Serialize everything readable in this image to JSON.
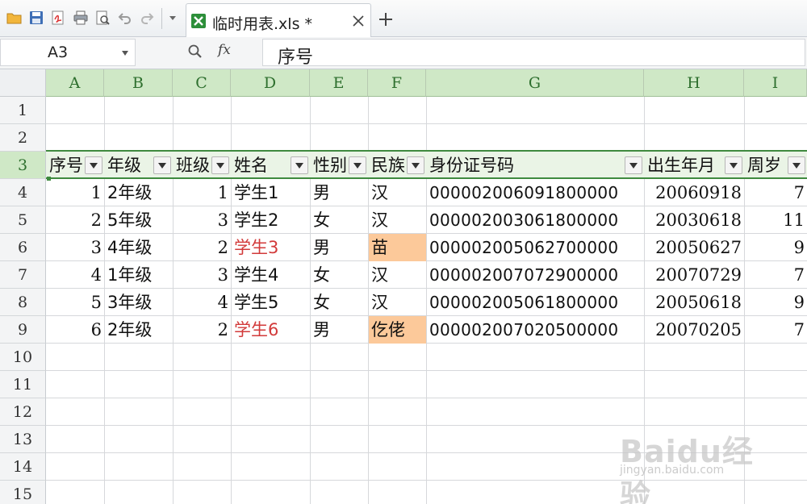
{
  "toolbar": {
    "icons": [
      "open-folder-icon",
      "save-icon",
      "export-pdf-icon",
      "print-icon",
      "print-preview-icon",
      "undo-icon",
      "redo-icon",
      "dropdown-icon"
    ],
    "tab": {
      "title": "临时用表.xls *",
      "icon": "excel-file-icon"
    }
  },
  "formula_bar": {
    "name_box": "A3",
    "fx_label": "fx",
    "formula": "序号"
  },
  "sheet": {
    "columns": [
      "A",
      "B",
      "C",
      "D",
      "E",
      "F",
      "G",
      "H",
      "I"
    ],
    "rows": [
      "1",
      "2",
      "3",
      "4",
      "5",
      "6",
      "7",
      "8",
      "9",
      "10",
      "11",
      "12",
      "13",
      "14",
      "15"
    ],
    "active_cell": "A3",
    "header_row": [
      "序号",
      "年级",
      "班级",
      "姓名",
      "性别",
      "民族",
      "身份证号码",
      "出生年月",
      "周岁"
    ],
    "data": [
      [
        "1",
        "2年级",
        "1",
        "学生1",
        "男",
        "汉",
        "000002006091800000",
        "20060918",
        "7"
      ],
      [
        "2",
        "5年级",
        "3",
        "学生2",
        "女",
        "汉",
        "000002003061800000",
        "20030618",
        "11"
      ],
      [
        "3",
        "4年级",
        "2",
        "学生3",
        "男",
        "苗",
        "000002005062700000",
        "20050627",
        "9"
      ],
      [
        "4",
        "1年级",
        "3",
        "学生4",
        "女",
        "汉",
        "000002007072900000",
        "20070729",
        "7"
      ],
      [
        "5",
        "3年级",
        "4",
        "学生5",
        "女",
        "汉",
        "000002005061800000",
        "20050618",
        "9"
      ],
      [
        "6",
        "2年级",
        "2",
        "学生6",
        "男",
        "仡佬",
        "000002007020500000",
        "20070205",
        "7"
      ]
    ],
    "highlight_color": "#fcc99a",
    "red_text_color": "#d23a3a",
    "header_green": "#cfe8c6"
  },
  "watermark": {
    "text": "Baidu经验",
    "sub": "jingyan.baidu.com"
  }
}
